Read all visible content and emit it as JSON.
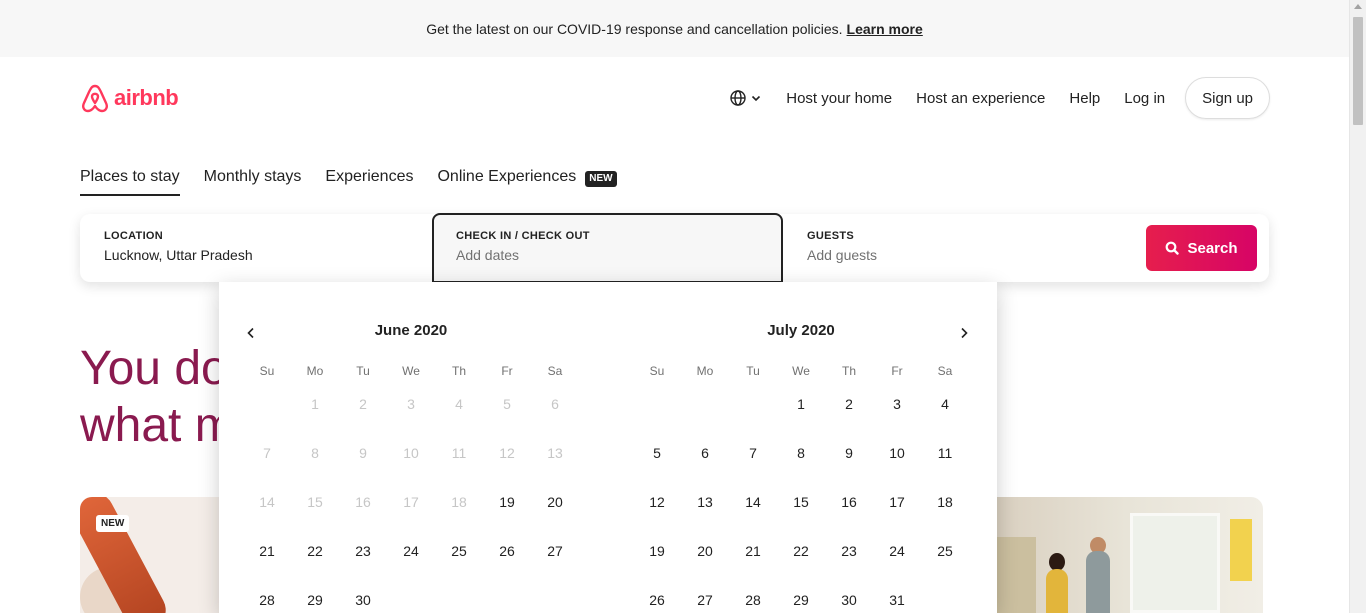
{
  "banner": {
    "text": "Get the latest on our COVID-19 response and cancellation policies.",
    "link": "Learn more"
  },
  "header": {
    "logo_text": "airbnb",
    "nav": {
      "host_home": "Host your home",
      "host_experience": "Host an experience",
      "help": "Help",
      "login": "Log in",
      "signup": "Sign up"
    }
  },
  "tabs": {
    "places": "Places to stay",
    "monthly": "Monthly stays",
    "experiences": "Experiences",
    "online": "Online Experiences",
    "online_badge": "NEW"
  },
  "search": {
    "location_label": "LOCATION",
    "location_value": "Lucknow, Uttar Pradesh",
    "dates_label": "CHECK IN / CHECK OUT",
    "dates_placeholder": "Add dates",
    "guests_label": "GUESTS",
    "guests_placeholder": "Add guests",
    "button": "Search"
  },
  "hero": {
    "line1": "You do",
    "line2": "what m"
  },
  "card": {
    "new_tag": "NEW"
  },
  "calendar": {
    "weekdays": [
      "Su",
      "Mo",
      "Tu",
      "We",
      "Th",
      "Fr",
      "Sa"
    ],
    "months": [
      {
        "title": "June 2020",
        "lead_blanks": 1,
        "days": 30,
        "disabled_through": 18
      },
      {
        "title": "July 2020",
        "lead_blanks": 3,
        "days": 31,
        "disabled_through": 0
      }
    ]
  },
  "colors": {
    "brand": "#ff385c",
    "hero_text": "#8a1a4f",
    "search_button": "#e61e4d"
  }
}
